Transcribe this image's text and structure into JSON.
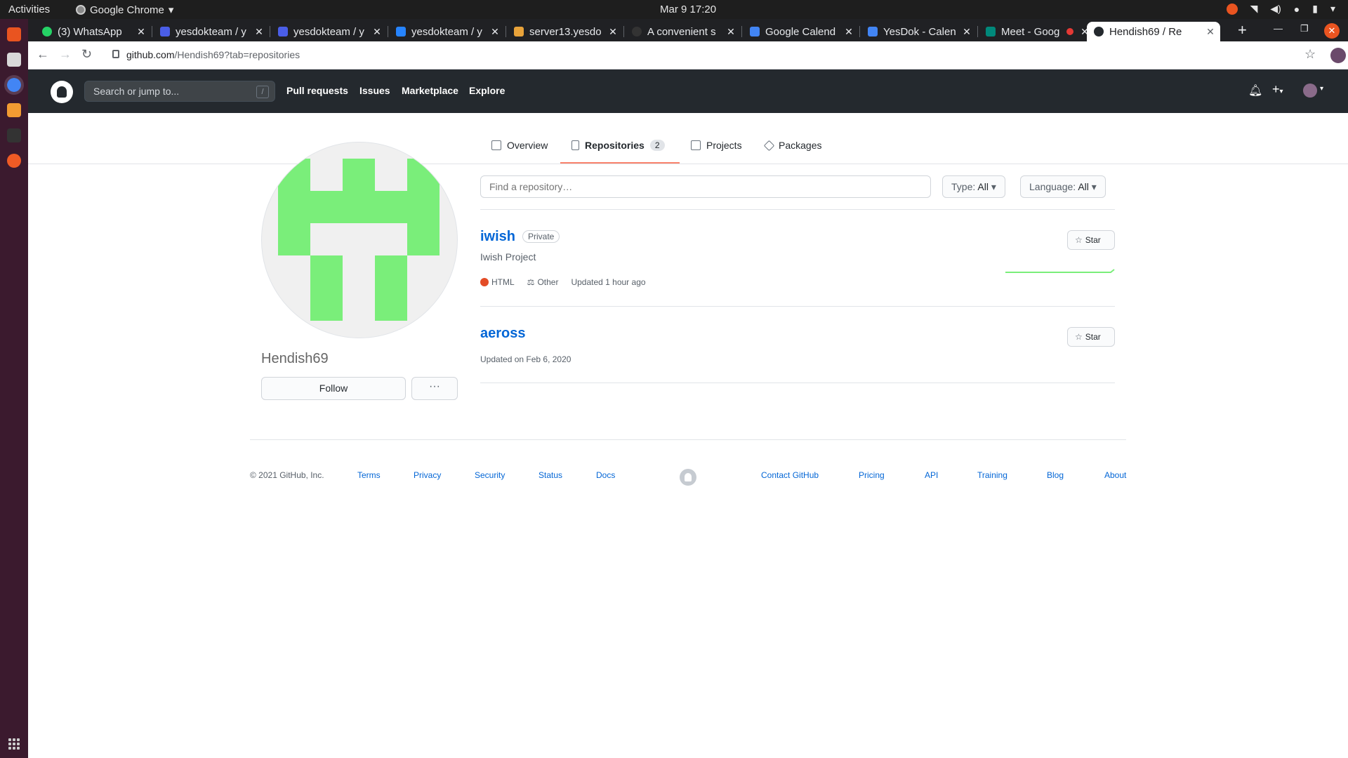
{
  "system": {
    "activities": "Activities",
    "app_name": "Google Chrome",
    "clock": "Mar 9  17:20"
  },
  "browser": {
    "tabs": [
      {
        "title": "(3) WhatsApp",
        "favicon_color": "#25d366"
      },
      {
        "title": "yesdokteam / y",
        "favicon_color": "#4a5ee8"
      },
      {
        "title": "yesdokteam / y",
        "favicon_color": "#4a5ee8"
      },
      {
        "title": "yesdokteam / y",
        "favicon_color": "#4a5ee8"
      },
      {
        "title": "server13.yesdo",
        "favicon_color": "#e8a33a"
      },
      {
        "title": "A convenient s",
        "favicon_color": "#333333"
      },
      {
        "title": "Google Calend",
        "favicon_color": "#4285f4"
      },
      {
        "title": "YesDok - Calen",
        "favicon_color": "#4285f4"
      },
      {
        "title": "Meet - Goog",
        "favicon_color": "#00897b"
      },
      {
        "title": "Hendish69 / Re",
        "favicon_color": "#24292e"
      }
    ],
    "active_tab_index": 9,
    "url_host": "github.com",
    "url_path": "/Hendish69?tab=repositories"
  },
  "github": {
    "search_placeholder": "Search or jump to...",
    "search_shortcut": "/",
    "nav": [
      "Pull requests",
      "Issues",
      "Marketplace",
      "Explore"
    ],
    "profile_tabs": [
      {
        "label": "Overview"
      },
      {
        "label": "Repositories",
        "count": "2"
      },
      {
        "label": "Projects"
      },
      {
        "label": "Packages"
      }
    ],
    "username": "Hendish69",
    "follow_label": "Follow",
    "more_label": "···",
    "find_placeholder": "Find a repository…",
    "type_filter": {
      "label": "Type:",
      "value": "All"
    },
    "language_filter": {
      "label": "Language:",
      "value": "All"
    },
    "repos": [
      {
        "name": "iwish",
        "visibility": "Private",
        "description": "Iwish Project",
        "language": "HTML",
        "language_color": "#e34c26",
        "license": "Other",
        "updated": "Updated 1 hour ago",
        "star_label": "Star"
      },
      {
        "name": "aeross",
        "updated": "Updated on Feb 6, 2020",
        "star_label": "Star"
      }
    ],
    "footer": {
      "copyright": "© 2021 GitHub, Inc.",
      "left_links": [
        "Terms",
        "Privacy",
        "Security",
        "Status",
        "Docs"
      ],
      "right_links": [
        "Contact GitHub",
        "Pricing",
        "API",
        "Training",
        "Blog",
        "About"
      ]
    }
  }
}
